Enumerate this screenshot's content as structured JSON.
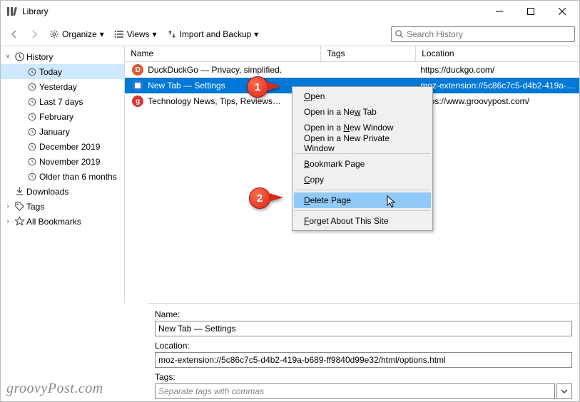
{
  "window": {
    "title": "Library"
  },
  "toolbar": {
    "organize": "Organize",
    "views": "Views",
    "import_backup": "Import and Backup"
  },
  "search": {
    "placeholder": "Search History"
  },
  "sidebar": {
    "history": "History",
    "items": [
      "Today",
      "Yesterday",
      "Last 7 days",
      "February",
      "January",
      "December 2019",
      "November 2019",
      "Older than 6 months"
    ],
    "downloads": "Downloads",
    "tags": "Tags",
    "all_bookmarks": "All Bookmarks"
  },
  "columns": {
    "name": "Name",
    "tags": "Tags",
    "location": "Location"
  },
  "rows": [
    {
      "title": "DuckDuckGo — Privacy, simplified.",
      "loc": "https://duckgo.com/",
      "color": "#de5833",
      "letter": "D"
    },
    {
      "title": "New Tab — Settings",
      "loc": "moz-extension://5c86c7c5-d4b2-419a-…",
      "color": "#2a7ad4",
      "letter": ""
    },
    {
      "title": "Technology News, Tips, Reviews…",
      "loc": "https://www.groovypost.com/",
      "color": "#d33",
      "letter": "g"
    }
  ],
  "contextmenu": {
    "open": "Open",
    "open_new_tab": "Open in a New Tab",
    "open_new_window": "Open in a New Window",
    "open_private": "Open in a New Private Window",
    "bookmark": "Bookmark Page",
    "copy": "Copy",
    "delete": "Delete Page",
    "forget": "Forget About This Site"
  },
  "details": {
    "name_label": "Name:",
    "name_value": "New Tab — Settings",
    "location_label": "Location:",
    "location_value": "moz-extension://5c86c7c5-d4b2-419a-b689-ff9840d99e32/html/options.html",
    "tags_label": "Tags:",
    "tags_placeholder": "Separate tags with commas"
  },
  "callouts": {
    "one": "1",
    "two": "2"
  },
  "watermark": "groovyPost.com"
}
